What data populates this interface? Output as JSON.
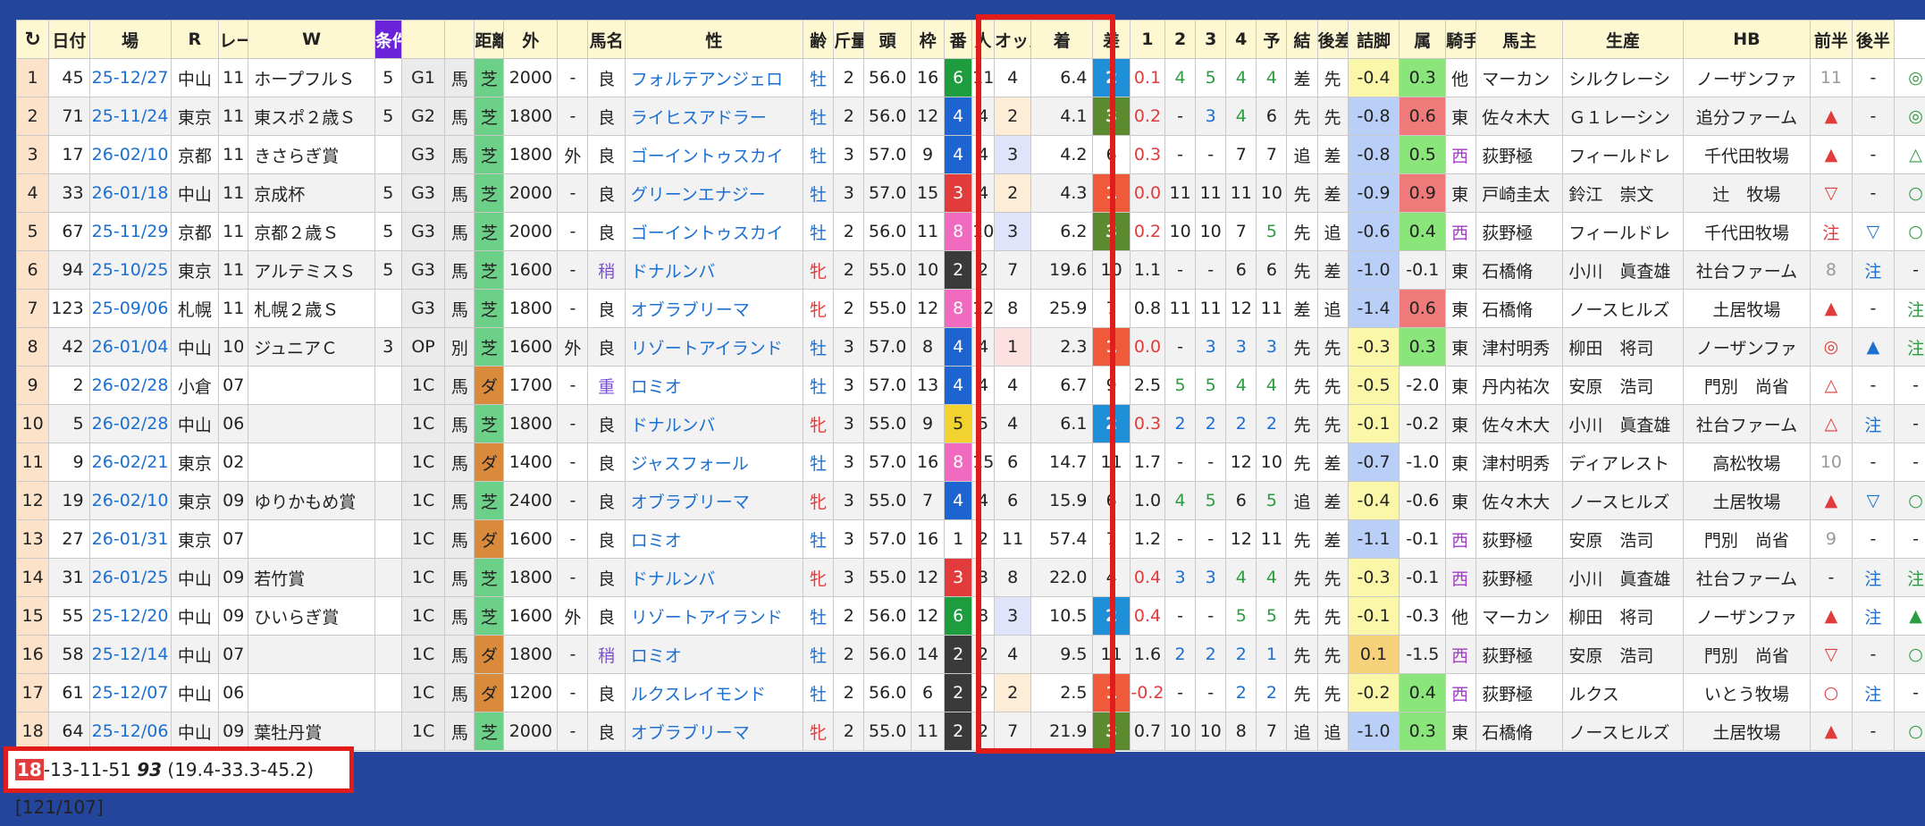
{
  "header": [
    "↻",
    "日付",
    "場",
    "R",
    "レース名",
    "W",
    "条件",
    "",
    "",
    "距離",
    "外",
    "",
    "馬名",
    "性",
    "齢",
    "斤量",
    "頭",
    "枠",
    "番",
    "人",
    "オッズ",
    "着",
    "差",
    "1",
    "2",
    "3",
    "4",
    "予",
    "結",
    "後差",
    "詰脚",
    "属",
    "騎手",
    "馬主",
    "生産",
    "HB",
    "前半",
    "後半"
  ],
  "rows": [
    [
      "1",
      "45",
      "25-12/27",
      "中山",
      "11",
      "ホープフルＳ",
      "5",
      "G1",
      "馬",
      "芝",
      "2000",
      "-",
      "良",
      "フォルテアンジェロ",
      "牡",
      "2",
      "56.0",
      "16",
      "6",
      "11",
      "4",
      "6.4",
      "2",
      "0.1",
      "4",
      "5",
      "4",
      "4",
      "差",
      "先",
      "-0.4",
      "0.3",
      "他",
      "マーカン",
      "シルクレーシ",
      "ノーザンファ",
      "11",
      "-",
      "◎"
    ],
    [
      "2",
      "71",
      "25-11/24",
      "東京",
      "11",
      "東スポ２歳Ｓ",
      "5",
      "G2",
      "馬",
      "芝",
      "1800",
      "-",
      "良",
      "ライヒスアドラー",
      "牡",
      "2",
      "56.0",
      "12",
      "4",
      "4",
      "2",
      "4.1",
      "3",
      "0.2",
      "-",
      "3",
      "4",
      "6",
      "先",
      "先",
      "-0.8",
      "0.6",
      "東",
      "佐々木大",
      "Ｇ１レーシン",
      "追分ファーム",
      "▲",
      "-",
      "◎"
    ],
    [
      "3",
      "17",
      "26-02/10",
      "京都",
      "11",
      "きさらぎ賞",
      "",
      "G3",
      "馬",
      "芝",
      "1800",
      "外",
      "良",
      "ゴーイントゥスカイ",
      "牡",
      "3",
      "57.0",
      "9",
      "4",
      "4",
      "3",
      "4.2",
      "6",
      "0.3",
      "-",
      "-",
      "7",
      "7",
      "追",
      "差",
      "-0.8",
      "0.5",
      "西",
      "荻野極",
      "フィールドレ",
      "千代田牧場",
      "▲",
      "-",
      "△"
    ],
    [
      "4",
      "33",
      "26-01/18",
      "中山",
      "11",
      "京成杯",
      "5",
      "G3",
      "馬",
      "芝",
      "2000",
      "-",
      "良",
      "グリーンエナジー",
      "牡",
      "3",
      "57.0",
      "15",
      "3",
      "4",
      "2",
      "4.3",
      "1",
      "0.0",
      "11",
      "11",
      "11",
      "10",
      "先",
      "差",
      "-0.9",
      "0.9",
      "東",
      "戸崎圭太",
      "鈴江　崇文",
      "辻　牧場",
      "▽",
      "-",
      "○"
    ],
    [
      "5",
      "67",
      "25-11/29",
      "京都",
      "11",
      "京都２歳Ｓ",
      "5",
      "G3",
      "馬",
      "芝",
      "2000",
      "-",
      "良",
      "ゴーイントゥスカイ",
      "牡",
      "2",
      "56.0",
      "11",
      "8",
      "10",
      "3",
      "6.2",
      "3",
      "0.2",
      "10",
      "10",
      "7",
      "5",
      "先",
      "追",
      "-0.6",
      "0.4",
      "西",
      "荻野極",
      "フィールドレ",
      "千代田牧場",
      "注",
      "▽",
      "○"
    ],
    [
      "6",
      "94",
      "25-10/25",
      "東京",
      "11",
      "アルテミスＳ",
      "5",
      "G3",
      "馬",
      "芝",
      "1600",
      "-",
      "稍",
      "ドナルンバ",
      "牝",
      "2",
      "55.0",
      "10",
      "2",
      "2",
      "7",
      "19.6",
      "10",
      "1.1",
      "-",
      "-",
      "6",
      "6",
      "先",
      "差",
      "-1.0",
      "-0.1",
      "東",
      "石橋脩",
      "小川　眞査雄",
      "社台ファーム",
      "8",
      "注",
      "-"
    ],
    [
      "7",
      "123",
      "25-09/06",
      "札幌",
      "11",
      "札幌２歳Ｓ",
      "",
      "G3",
      "馬",
      "芝",
      "1800",
      "-",
      "良",
      "オブラブリーマ",
      "牝",
      "2",
      "55.0",
      "12",
      "8",
      "12",
      "8",
      "25.9",
      "7",
      "0.8",
      "11",
      "11",
      "12",
      "11",
      "差",
      "追",
      "-1.4",
      "0.6",
      "東",
      "石橋脩",
      "ノースヒルズ",
      "土居牧場",
      "▲",
      "-",
      "注"
    ],
    [
      "8",
      "42",
      "26-01/04",
      "中山",
      "10",
      "ジュニアＣ",
      "3",
      "OP",
      "別",
      "芝",
      "1600",
      "外",
      "良",
      "リゾートアイランド",
      "牡",
      "3",
      "57.0",
      "8",
      "4",
      "4",
      "1",
      "2.3",
      "1",
      "0.0",
      "-",
      "3",
      "3",
      "3",
      "先",
      "先",
      "-0.3",
      "0.3",
      "東",
      "津村明秀",
      "柳田　将司",
      "ノーザンファ",
      "◎",
      "▲",
      "注"
    ],
    [
      "9",
      "2",
      "26-02/28",
      "小倉",
      "07",
      "",
      "",
      "1C",
      "馬",
      "ダ",
      "1700",
      "-",
      "重",
      "ロミオ",
      "牡",
      "3",
      "57.0",
      "13",
      "4",
      "4",
      "4",
      "6.7",
      "9",
      "2.5",
      "5",
      "5",
      "4",
      "4",
      "先",
      "先",
      "-0.5",
      "-2.0",
      "東",
      "丹内祐次",
      "安原　浩司",
      "門別　尚省",
      "△",
      "-",
      "-"
    ],
    [
      "10",
      "5",
      "26-02/28",
      "中山",
      "06",
      "",
      "",
      "1C",
      "馬",
      "芝",
      "1800",
      "-",
      "良",
      "ドナルンバ",
      "牝",
      "3",
      "55.0",
      "9",
      "5",
      "5",
      "4",
      "6.1",
      "2",
      "0.3",
      "2",
      "2",
      "2",
      "2",
      "先",
      "先",
      "-0.1",
      "-0.2",
      "東",
      "佐々木大",
      "小川　眞査雄",
      "社台ファーム",
      "△",
      "注",
      "-"
    ],
    [
      "11",
      "9",
      "26-02/21",
      "東京",
      "02",
      "",
      "",
      "1C",
      "馬",
      "ダ",
      "1400",
      "-",
      "良",
      "ジャスフォール",
      "牡",
      "3",
      "57.0",
      "16",
      "8",
      "15",
      "6",
      "14.7",
      "11",
      "1.7",
      "-",
      "-",
      "12",
      "10",
      "先",
      "差",
      "-0.7",
      "-1.0",
      "東",
      "津村明秀",
      "ディアレスト",
      "高松牧場",
      "10",
      "-",
      "-"
    ],
    [
      "12",
      "19",
      "26-02/10",
      "東京",
      "09",
      "ゆりかもめ賞",
      "",
      "1C",
      "馬",
      "芝",
      "2400",
      "-",
      "良",
      "オブラブリーマ",
      "牝",
      "3",
      "55.0",
      "7",
      "4",
      "4",
      "6",
      "15.9",
      "6",
      "1.0",
      "4",
      "5",
      "6",
      "5",
      "追",
      "差",
      "-0.4",
      "-0.6",
      "東",
      "佐々木大",
      "ノースヒルズ",
      "土居牧場",
      "▲",
      "▽",
      "○"
    ],
    [
      "13",
      "27",
      "26-01/31",
      "東京",
      "07",
      "",
      "",
      "1C",
      "馬",
      "ダ",
      "1600",
      "-",
      "良",
      "ロミオ",
      "牡",
      "3",
      "57.0",
      "16",
      "1",
      "2",
      "11",
      "57.4",
      "7",
      "1.2",
      "-",
      "-",
      "12",
      "11",
      "先",
      "差",
      "-1.1",
      "-0.1",
      "西",
      "荻野極",
      "安原　浩司",
      "門別　尚省",
      "9",
      "-",
      "-"
    ],
    [
      "14",
      "31",
      "26-01/25",
      "中山",
      "09",
      "若竹賞",
      "",
      "1C",
      "馬",
      "芝",
      "1800",
      "-",
      "良",
      "ドナルンバ",
      "牝",
      "3",
      "55.0",
      "12",
      "3",
      "3",
      "8",
      "22.0",
      "4",
      "0.4",
      "3",
      "3",
      "4",
      "4",
      "先",
      "先",
      "-0.3",
      "-0.1",
      "西",
      "荻野極",
      "小川　眞査雄",
      "社台ファーム",
      "-",
      "注",
      "注"
    ],
    [
      "15",
      "55",
      "25-12/20",
      "中山",
      "09",
      "ひいらぎ賞",
      "",
      "1C",
      "馬",
      "芝",
      "1600",
      "外",
      "良",
      "リゾートアイランド",
      "牡",
      "2",
      "56.0",
      "12",
      "6",
      "8",
      "3",
      "10.5",
      "2",
      "0.4",
      "-",
      "-",
      "5",
      "5",
      "先",
      "先",
      "-0.1",
      "-0.3",
      "他",
      "マーカン",
      "柳田　将司",
      "ノーザンファ",
      "▲",
      "注",
      "▲"
    ],
    [
      "16",
      "58",
      "25-12/14",
      "中山",
      "07",
      "",
      "",
      "1C",
      "馬",
      "ダ",
      "1800",
      "-",
      "稍",
      "ロミオ",
      "牡",
      "2",
      "56.0",
      "14",
      "2",
      "2",
      "4",
      "9.5",
      "11",
      "1.6",
      "2",
      "2",
      "2",
      "1",
      "先",
      "先",
      "0.1",
      "-1.5",
      "西",
      "荻野極",
      "安原　浩司",
      "門別　尚省",
      "▽",
      "-",
      "○"
    ],
    [
      "17",
      "61",
      "25-12/07",
      "中山",
      "06",
      "",
      "",
      "1C",
      "馬",
      "ダ",
      "1200",
      "-",
      "良",
      "ルクスレイモンド",
      "牡",
      "2",
      "56.0",
      "6",
      "2",
      "2",
      "2",
      "2.5",
      "1",
      "-0.2",
      "-",
      "-",
      "2",
      "2",
      "先",
      "先",
      "-0.2",
      "0.4",
      "西",
      "荻野極",
      "ルクス",
      "いとう牧場",
      "○",
      "注",
      "-"
    ],
    [
      "18",
      "64",
      "25-12/06",
      "中山",
      "09",
      "葉牡丹賞",
      "",
      "1C",
      "馬",
      "芝",
      "2000",
      "-",
      "良",
      "オブラブリーマ",
      "牝",
      "2",
      "55.0",
      "11",
      "2",
      "2",
      "7",
      "21.9",
      "3",
      "0.7",
      "10",
      "10",
      "8",
      "7",
      "追",
      "追",
      "-1.0",
      "0.3",
      "東",
      "石橋脩",
      "ノースヒルズ",
      "土居牧場",
      "▲",
      "-",
      "○"
    ]
  ],
  "footer": {
    "record": "18",
    "rest": "-13-11-51 ",
    "score": "93",
    "tail": " (19.4-33.3-45.2) [121/107]"
  }
}
